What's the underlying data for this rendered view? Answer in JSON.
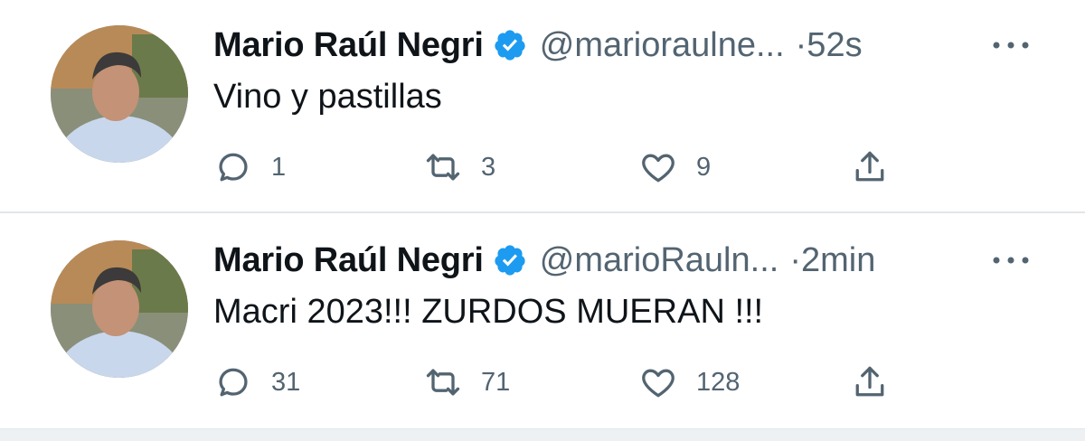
{
  "tweets": [
    {
      "author_name": "Mario Raúl Negri",
      "handle": "@marioraulne...",
      "time": "·52s",
      "text": "Vino y pastillas",
      "reply_count": "1",
      "retweet_count": "3",
      "like_count": "9"
    },
    {
      "author_name": "Mario Raúl Negri",
      "handle": "@marioRauln...",
      "time": "·2min",
      "text": "Macri 2023!!! ZURDOS MUERAN !!!",
      "reply_count": "31",
      "retweet_count": "71",
      "like_count": "128"
    }
  ],
  "icons": {
    "verified": "verified-badge-icon",
    "more": "more-dots-icon",
    "reply": "reply-icon",
    "retweet": "retweet-icon",
    "like": "heart-icon",
    "share": "share-icon"
  },
  "colors": {
    "verified": "#1d9bf0",
    "secondary_text": "#536471",
    "primary_text": "#0f1419"
  }
}
